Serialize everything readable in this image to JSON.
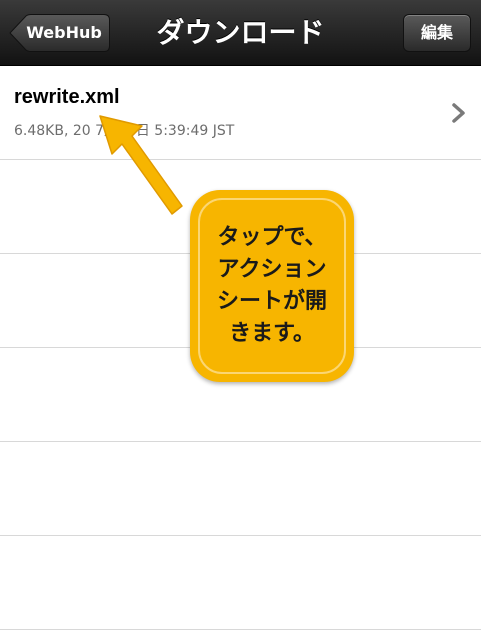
{
  "navbar": {
    "title": "ダウンロード",
    "back_label": "WebHub",
    "edit_label": "編集"
  },
  "list": {
    "items": [
      {
        "name": "rewrite.xml",
        "subtitle": "6.48KB, 20  7月14日 5:39:49 JST"
      }
    ]
  },
  "annotation": {
    "lines": [
      "タップで、",
      "アクション",
      "シートが開",
      "きます。"
    ],
    "color": "#f7b500"
  },
  "icons": {
    "back": "back-arrow-icon",
    "disclosure": "chevron-right-icon",
    "pointer": "arrow-pointer-icon"
  }
}
